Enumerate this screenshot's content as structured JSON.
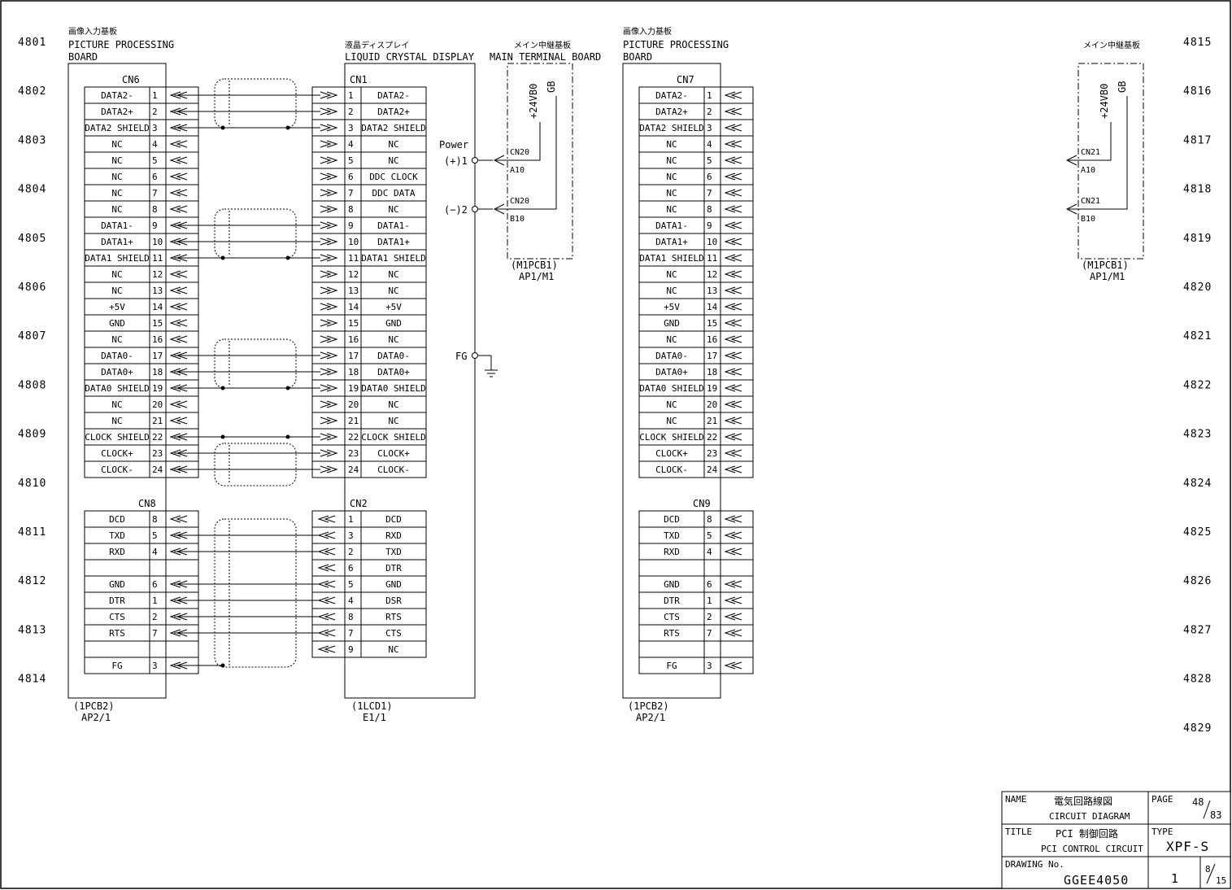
{
  "row_numbers_left": [
    "4801",
    "4802",
    "4803",
    "4804",
    "4805",
    "4806",
    "4807",
    "4808",
    "4809",
    "4810",
    "4811",
    "4812",
    "4813",
    "4814"
  ],
  "row_numbers_right": [
    "4815",
    "4816",
    "4817",
    "4818",
    "4819",
    "4820",
    "4821",
    "4822",
    "4823",
    "4824",
    "4825",
    "4826",
    "4827",
    "4828",
    "4829"
  ],
  "boards": {
    "pcb_left": {
      "jp": "画像入力基板",
      "title1": "PICTURE PROCESSING",
      "title2": "BOARD",
      "cn_top": "CN6",
      "cn_bottom": "CN8",
      "ref1": "(1PCB2)",
      "ref2": "AP2/1"
    },
    "pcb_right": {
      "jp": "画像入力基板",
      "title1": "PICTURE PROCESSING",
      "title2": "BOARD",
      "cn_top": "CN7",
      "cn_bottom": "CN9",
      "ref1": "(1PCB2)",
      "ref2": "AP2/1"
    },
    "lcd": {
      "jp": "液晶ディスプレイ",
      "title": "LIQUID CRYSTAL DISPLAY",
      "cn_top": "CN1",
      "cn_bottom": "CN2",
      "ref1": "(1LCD1)",
      "ref2": "E1/1",
      "power": "Power",
      "pin1": "(+)1",
      "pin2": "(−)2",
      "fg": "FG"
    },
    "main1": {
      "jp": "メイン中継基板",
      "title": "MAIN TERMINAL BOARD",
      "v1": "+24VB0",
      "v2": "GB",
      "cn_a": "CN20",
      "pin_a": "A10",
      "cn_b": "CN20",
      "pin_b": "B10",
      "ref1": "(M1PCB1)",
      "ref2": "AP1/M1"
    },
    "main2": {
      "jp": "メイン中継基板",
      "v1": "+24VB0",
      "v2": "GB",
      "cn_a": "CN21",
      "pin_a": "A10",
      "cn_b": "CN21",
      "pin_b": "B10",
      "ref1": "(M1PCB1)",
      "ref2": "AP1/M1"
    }
  },
  "cn6_rows": [
    {
      "name": "DATA2-",
      "pin": "1"
    },
    {
      "name": "DATA2+",
      "pin": "2"
    },
    {
      "name": "DATA2 SHIELD",
      "pin": "3"
    },
    {
      "name": "NC",
      "pin": "4"
    },
    {
      "name": "NC",
      "pin": "5"
    },
    {
      "name": "NC",
      "pin": "6"
    },
    {
      "name": "NC",
      "pin": "7"
    },
    {
      "name": "NC",
      "pin": "8"
    },
    {
      "name": "DATA1-",
      "pin": "9"
    },
    {
      "name": "DATA1+",
      "pin": "10"
    },
    {
      "name": "DATA1 SHIELD",
      "pin": "11"
    },
    {
      "name": "NC",
      "pin": "12"
    },
    {
      "name": "NC",
      "pin": "13"
    },
    {
      "name": "+5V",
      "pin": "14"
    },
    {
      "name": "GND",
      "pin": "15"
    },
    {
      "name": "NC",
      "pin": "16"
    },
    {
      "name": "DATA0-",
      "pin": "17"
    },
    {
      "name": "DATA0+",
      "pin": "18"
    },
    {
      "name": "DATA0 SHIELD",
      "pin": "19"
    },
    {
      "name": "NC",
      "pin": "20"
    },
    {
      "name": "NC",
      "pin": "21"
    },
    {
      "name": "CLOCK SHIELD",
      "pin": "22"
    },
    {
      "name": "CLOCK+",
      "pin": "23"
    },
    {
      "name": "CLOCK-",
      "pin": "24"
    }
  ],
  "cn1_rows": [
    {
      "name": "DATA2-",
      "pin": "1"
    },
    {
      "name": "DATA2+",
      "pin": "2"
    },
    {
      "name": "DATA2 SHIELD",
      "pin": "3"
    },
    {
      "name": "NC",
      "pin": "4"
    },
    {
      "name": "NC",
      "pin": "5"
    },
    {
      "name": "DDC CLOCK",
      "pin": "6"
    },
    {
      "name": "DDC DATA",
      "pin": "7"
    },
    {
      "name": "NC",
      "pin": "8"
    },
    {
      "name": "DATA1-",
      "pin": "9"
    },
    {
      "name": "DATA1+",
      "pin": "10"
    },
    {
      "name": "DATA1 SHIELD",
      "pin": "11"
    },
    {
      "name": "NC",
      "pin": "12"
    },
    {
      "name": "NC",
      "pin": "13"
    },
    {
      "name": "+5V",
      "pin": "14"
    },
    {
      "name": "GND",
      "pin": "15"
    },
    {
      "name": "NC",
      "pin": "16"
    },
    {
      "name": "DATA0-",
      "pin": "17"
    },
    {
      "name": "DATA0+",
      "pin": "18"
    },
    {
      "name": "DATA0 SHIELD",
      "pin": "19"
    },
    {
      "name": "NC",
      "pin": "20"
    },
    {
      "name": "NC",
      "pin": "21"
    },
    {
      "name": "CLOCK SHIELD",
      "pin": "22"
    },
    {
      "name": "CLOCK+",
      "pin": "23"
    },
    {
      "name": "CLOCK-",
      "pin": "24"
    }
  ],
  "cn8_rows": [
    {
      "name": "DCD",
      "pin": "8"
    },
    {
      "name": "TXD",
      "pin": "5"
    },
    {
      "name": "RXD",
      "pin": "4"
    },
    {
      "name": "",
      "pin": ""
    },
    {
      "name": "GND",
      "pin": "6"
    },
    {
      "name": "DTR",
      "pin": "1"
    },
    {
      "name": "CTS",
      "pin": "2"
    },
    {
      "name": "RTS",
      "pin": "7"
    },
    {
      "name": "",
      "pin": ""
    },
    {
      "name": "FG",
      "pin": "3"
    }
  ],
  "cn2_rows": [
    {
      "name": "DCD",
      "pin": "1"
    },
    {
      "name": "RXD",
      "pin": "3"
    },
    {
      "name": "TXD",
      "pin": "2"
    },
    {
      "name": "DTR",
      "pin": "6"
    },
    {
      "name": "GND",
      "pin": "5"
    },
    {
      "name": "DSR",
      "pin": "4"
    },
    {
      "name": "RTS",
      "pin": "8"
    },
    {
      "name": "CTS",
      "pin": "7"
    },
    {
      "name": "NC",
      "pin": "9"
    }
  ],
  "title_block": {
    "name_label": "NAME",
    "name_jp": "電気回路線図",
    "name_en": "CIRCUIT DIAGRAM",
    "title_label": "TITLE",
    "title_jp": "PCI 制御回路",
    "title_en": "PCI CONTROL CIRCUIT",
    "drawing_label": "DRAWING No.",
    "drawing_no": "GGEE4050",
    "page_label": "PAGE",
    "page_num": "48",
    "page_total": "83",
    "type_label": "TYPE",
    "type_value": "XPF-S",
    "rev": "1",
    "sheet_num": "8",
    "sheet_total": "15"
  }
}
